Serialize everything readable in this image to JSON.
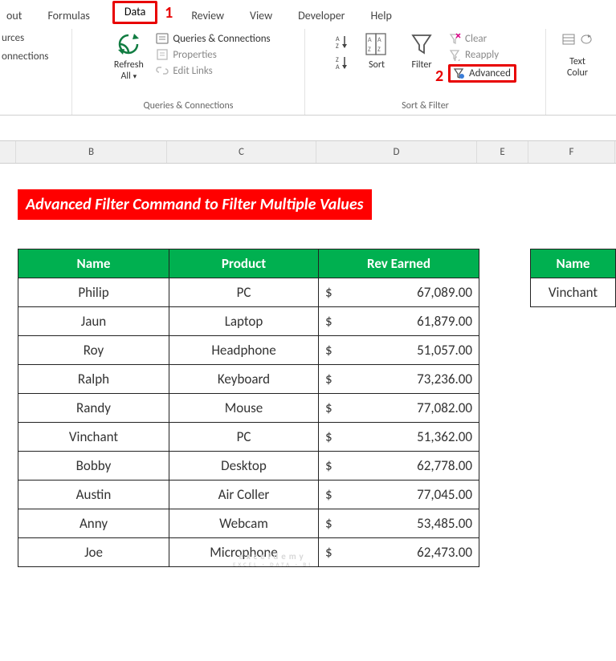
{
  "ribbon": {
    "tabs": [
      "out",
      "Formulas",
      "Data",
      "Review",
      "View",
      "Developer",
      "Help"
    ],
    "active_tab": "Data",
    "callout1": "1",
    "callout2": "2",
    "getdata": {
      "line1": "urces",
      "line2": "onnections"
    },
    "refresh": {
      "label1": "Refresh",
      "label2": "All"
    },
    "queries": {
      "qc": "Queries & Connections",
      "props": "Properties",
      "links": "Edit Links",
      "group_label": "Queries & Connections"
    },
    "sort": {
      "sort_label": "Sort"
    },
    "filter": {
      "filter_label": "Filter",
      "clear": "Clear",
      "reapply": "Reapply",
      "advanced": "Advanced",
      "group_label": "Sort & Filter"
    },
    "text": {
      "label1": "Text",
      "label2": "Colur"
    }
  },
  "columns": [
    "B",
    "C",
    "D",
    "E",
    "F"
  ],
  "title_banner": "Advanced Filter Command to Filter Multiple Values",
  "table": {
    "headers": {
      "name": "Name",
      "product": "Product",
      "rev": "Rev Earned"
    },
    "rows": [
      {
        "name": "Philip",
        "product": "PC",
        "rev": "67,089.00"
      },
      {
        "name": "Jaun",
        "product": "Laptop",
        "rev": "61,879.00"
      },
      {
        "name": "Roy",
        "product": "Headphone",
        "rev": "51,057.00"
      },
      {
        "name": "Ralph",
        "product": "Keyboard",
        "rev": "73,236.00"
      },
      {
        "name": "Randy",
        "product": "Mouse",
        "rev": "77,082.00"
      },
      {
        "name": "Vinchant",
        "product": "PC",
        "rev": "51,362.00"
      },
      {
        "name": "Bobby",
        "product": "Desktop",
        "rev": "62,778.00"
      },
      {
        "name": "Austin",
        "product": "Air Coller",
        "rev": "77,045.00"
      },
      {
        "name": "Anny",
        "product": "Webcam",
        "rev": "53,485.00"
      },
      {
        "name": "Joe",
        "product": "Microphone",
        "rev": "62,473.00"
      }
    ],
    "currency": "$"
  },
  "criteria": {
    "header": "Name",
    "value": "Vinchant"
  },
  "watermark": {
    "main": "exceldemy",
    "sub": "EXCEL · DATA · BI"
  }
}
